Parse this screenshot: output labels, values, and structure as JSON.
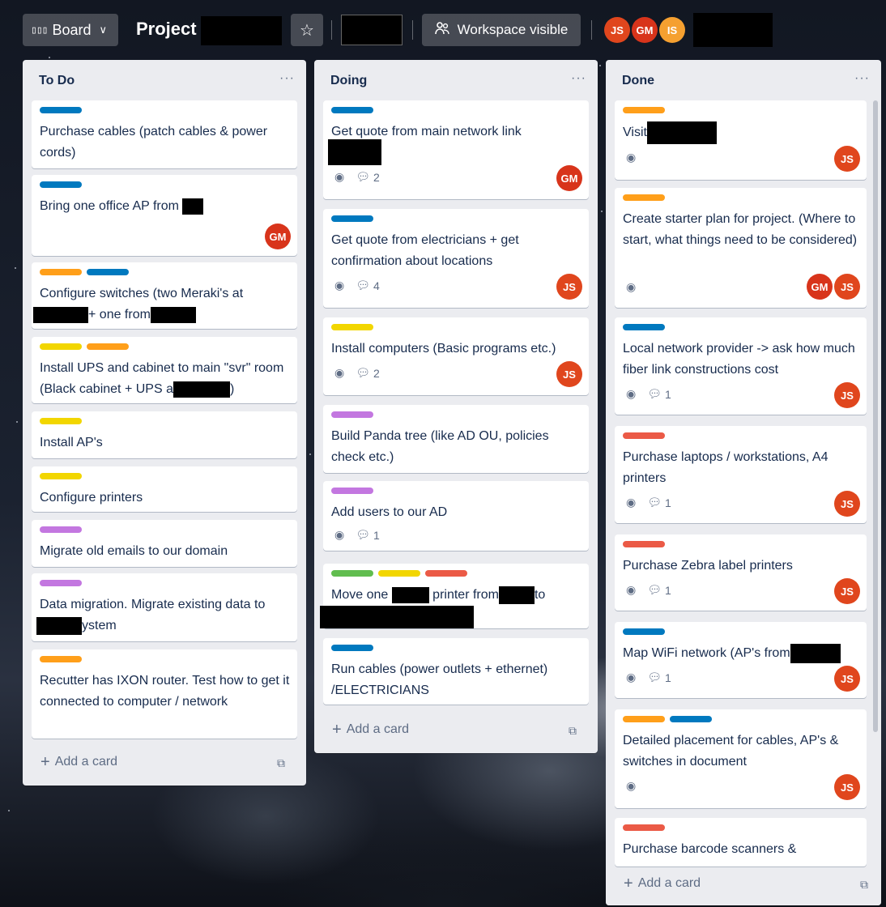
{
  "header": {
    "board_label": "Board",
    "board_icon": "⊞",
    "project_title": "Project",
    "star_icon": "☆",
    "workspace_label": "Workspace visible",
    "workspace_icon": "⛬",
    "members": [
      "JS",
      "GM",
      "IS"
    ]
  },
  "add_card_label": "Add a card",
  "lists": [
    {
      "title": "To Do",
      "cards": [
        {
          "title": "Purchase cables (patch cables & power cords)"
        },
        {
          "title": "Bring one office AP from",
          "avatars": [
            "GM"
          ]
        },
        {
          "title": "Configure switches (two Meraki's at",
          "title_line2": "+ one from"
        },
        {
          "title": "Install UPS and cabinet to main \"svr\" room (Black cabinet + UPS a",
          "title_end": ")"
        },
        {
          "title": "Install AP's"
        },
        {
          "title": "Configure printers"
        },
        {
          "title": "Migrate old emails to our domain"
        },
        {
          "title": "Data migration. Migrate existing data to",
          "title_line2": "ystem"
        },
        {
          "title": "Recutter has IXON router. Test how to get it connected to computer / network"
        }
      ]
    },
    {
      "title": "Doing",
      "cards": [
        {
          "title": "Get quote from main network link",
          "comments": "2",
          "avatars": [
            "GM"
          ]
        },
        {
          "title": "Get quote from electricians + get confirmation about locations",
          "comments": "4",
          "avatars": [
            "JS"
          ]
        },
        {
          "title": "Install computers (Basic programs etc.)",
          "comments": "2",
          "avatars": [
            "JS"
          ]
        },
        {
          "title": "Build Panda tree (like AD OU, policies check etc.)"
        },
        {
          "title": "Add users to our AD",
          "comments": "1"
        },
        {
          "title": "Move one",
          "title_mid": "printer from",
          "title_end": "to"
        },
        {
          "title": "Run cables (power outlets + ethernet) /ELECTRICIANS"
        }
      ]
    },
    {
      "title": "Done",
      "cards": [
        {
          "title": "Visit",
          "avatars": [
            "JS"
          ]
        },
        {
          "title": "Create starter plan for project. (Where to start, what things need to be considered)",
          "avatars": [
            "GM",
            "JS"
          ]
        },
        {
          "title": "Local network provider -> ask how much fiber link constructions cost",
          "comments": "1",
          "avatars": [
            "JS"
          ]
        },
        {
          "title": "Purchase laptops / workstations, A4 printers",
          "comments": "1",
          "avatars": [
            "JS"
          ]
        },
        {
          "title": "Purchase Zebra label printers",
          "comments": "1",
          "avatars": [
            "JS"
          ]
        },
        {
          "title": "Map WiFi network (AP's from",
          "comments": "1",
          "avatars": [
            "JS"
          ]
        },
        {
          "title": "Detailed placement for cables, AP's & switches in document",
          "avatars": [
            "JS"
          ]
        },
        {
          "title": "Purchase barcode scanners &"
        }
      ]
    }
  ],
  "colors": {
    "blue": "#0079bf",
    "orange": "#ff9f1a",
    "yellow": "#f2d600",
    "purple": "#c377e0",
    "green": "#61bd4f",
    "red": "#eb5a46"
  }
}
